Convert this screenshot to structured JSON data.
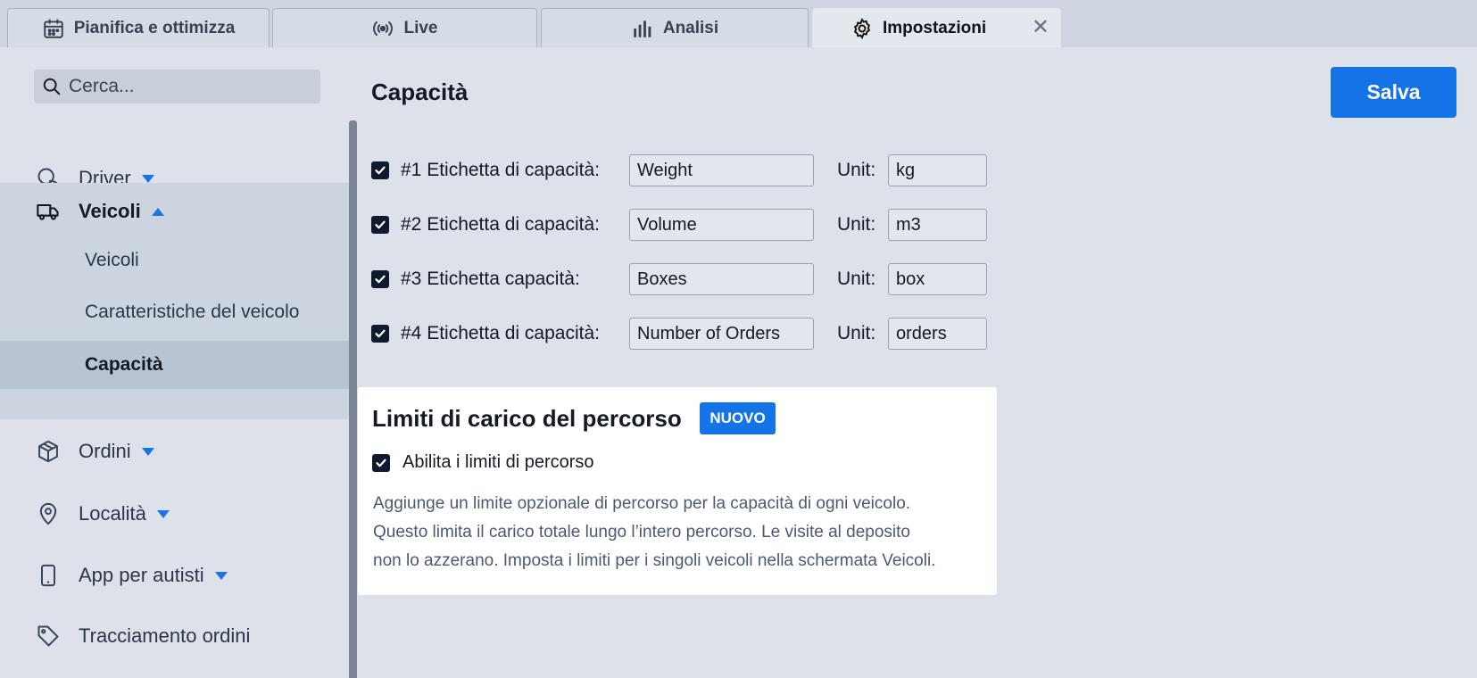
{
  "tabs": [
    {
      "label": "Pianifica e ottimizza",
      "icon": "calendar-icon"
    },
    {
      "label": "Live",
      "icon": "broadcast-icon"
    },
    {
      "label": "Analisi",
      "icon": "bar-chart-icon"
    },
    {
      "label": "Impostazioni",
      "icon": "gear-icon",
      "active": true
    }
  ],
  "tab_close": "✕",
  "search": {
    "placeholder": "Cerca..."
  },
  "sidebar": {
    "items": [
      {
        "label": "Driver",
        "icon": "driver-icon",
        "expanded": false
      },
      {
        "label": "Veicoli",
        "icon": "truck-icon",
        "expanded": true
      },
      {
        "label": "Ordini",
        "icon": "box-icon",
        "expanded": false
      },
      {
        "label": "Località",
        "icon": "location-pin-icon",
        "expanded": false
      },
      {
        "label": "App per autisti",
        "icon": "phone-icon",
        "expanded": false
      },
      {
        "label": "Tracciamento ordini",
        "icon": "tag-icon"
      }
    ],
    "veicoli_sub": [
      {
        "label": "Veicoli"
      },
      {
        "label": "Caratteristiche del veicolo"
      },
      {
        "label": "Capacità",
        "active": true
      }
    ]
  },
  "main": {
    "title": "Capacità",
    "save_label": "Salva",
    "unit_label": "Unit:",
    "capacities": [
      {
        "label": "#1 Etichetta di capacità:",
        "value": "Weight",
        "unit": "kg",
        "checked": true
      },
      {
        "label": "#2 Etichetta di capacità:",
        "value": "Volume",
        "unit": "m3",
        "checked": true
      },
      {
        "label": "#3 Etichetta capacità:",
        "value": "Boxes",
        "unit": "box",
        "checked": true
      },
      {
        "label": "#4 Etichetta di capacità:",
        "value": "Number of Orders",
        "unit": "orders",
        "checked": true
      }
    ]
  },
  "route_limits": {
    "title": "Limiti di carico del percorso",
    "badge": "NUOVO",
    "checkbox_label": "Abilita i limiti di percorso",
    "checked": true,
    "description_lines": [
      "Aggiunge un limite opzionale di percorso per la capacità di ogni veicolo.",
      "Questo limita il carico totale lungo l’intero percorso. Le visite al deposito",
      "non lo azzerano. Imposta i limiti per i singoli veicoli nella schermata Veicoli."
    ]
  },
  "colors": {
    "accent": "#1473e6",
    "page_bg": "#dde1e9",
    "sidebar_selected": "#b9c4d3",
    "checkbox": "#0f1a2e"
  }
}
